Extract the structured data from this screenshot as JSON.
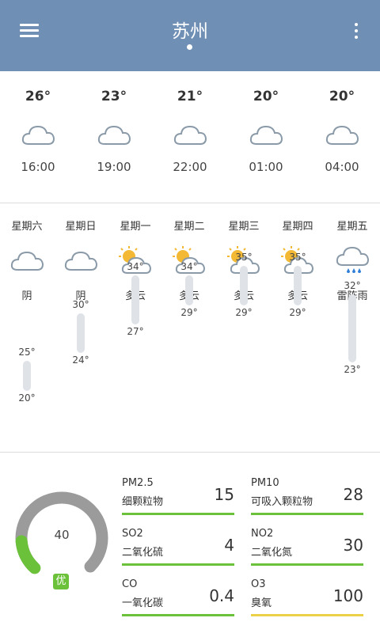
{
  "header": {
    "city": "苏州"
  },
  "hourly": [
    {
      "temp": "26°",
      "time": "16:00",
      "icon": "cloud-icon"
    },
    {
      "temp": "23°",
      "time": "19:00",
      "icon": "cloud-icon"
    },
    {
      "temp": "21°",
      "time": "22:00",
      "icon": "cloud-icon"
    },
    {
      "temp": "20°",
      "time": "01:00",
      "icon": "cloud-icon"
    },
    {
      "temp": "20°",
      "time": "04:00",
      "icon": "cloud-icon"
    }
  ],
  "daily": [
    {
      "day": "星期六",
      "condition": "阴",
      "icon": "cloud-icon",
      "high": "25°",
      "low": "20°",
      "high_v": 25,
      "low_v": 20
    },
    {
      "day": "星期日",
      "condition": "阴",
      "icon": "cloud-icon",
      "high": "30°",
      "low": "24°",
      "high_v": 30,
      "low_v": 24
    },
    {
      "day": "星期一",
      "condition": "多云",
      "icon": "partly-cloudy-icon",
      "high": "34°",
      "low": "27°",
      "high_v": 34,
      "low_v": 27
    },
    {
      "day": "星期二",
      "condition": "多云",
      "icon": "partly-cloudy-icon",
      "high": "34°",
      "low": "29°",
      "high_v": 34,
      "low_v": 29
    },
    {
      "day": "星期三",
      "condition": "多云",
      "icon": "partly-cloudy-icon",
      "high": "35°",
      "low": "29°",
      "high_v": 35,
      "low_v": 29
    },
    {
      "day": "星期四",
      "condition": "多云",
      "icon": "partly-cloudy-icon",
      "high": "35°",
      "low": "29°",
      "high_v": 35,
      "low_v": 29
    },
    {
      "day": "星期五",
      "condition": "雷阵雨",
      "icon": "thunderstorm-icon",
      "high": "32°",
      "low": "23°",
      "high_v": 32,
      "low_v": 23
    }
  ],
  "air_quality": {
    "aqi": "40",
    "aqi_fraction": 0.15,
    "level": "优",
    "level_color": "#6cc13b",
    "pollutants": [
      {
        "code": "PM2.5",
        "label": "细颗粒物",
        "value": "15",
        "color": "#6cc13b"
      },
      {
        "code": "PM10",
        "label": "可吸入颗粒物",
        "value": "28",
        "color": "#6cc13b"
      },
      {
        "code": "SO2",
        "label": "二氧化硫",
        "value": "4",
        "color": "#6cc13b"
      },
      {
        "code": "NO2",
        "label": "二氧化氮",
        "value": "30",
        "color": "#6cc13b"
      },
      {
        "code": "CO",
        "label": "一氧化碳",
        "value": "0.4",
        "color": "#6cc13b"
      },
      {
        "code": "O3",
        "label": "臭氧",
        "value": "100",
        "color": "#ead148"
      }
    ]
  },
  "colors": {
    "header_bg": "#6f8fb5",
    "range_bar": "#dfe3e8",
    "sun": "#f3b935",
    "rain": "#2f7fd6"
  }
}
